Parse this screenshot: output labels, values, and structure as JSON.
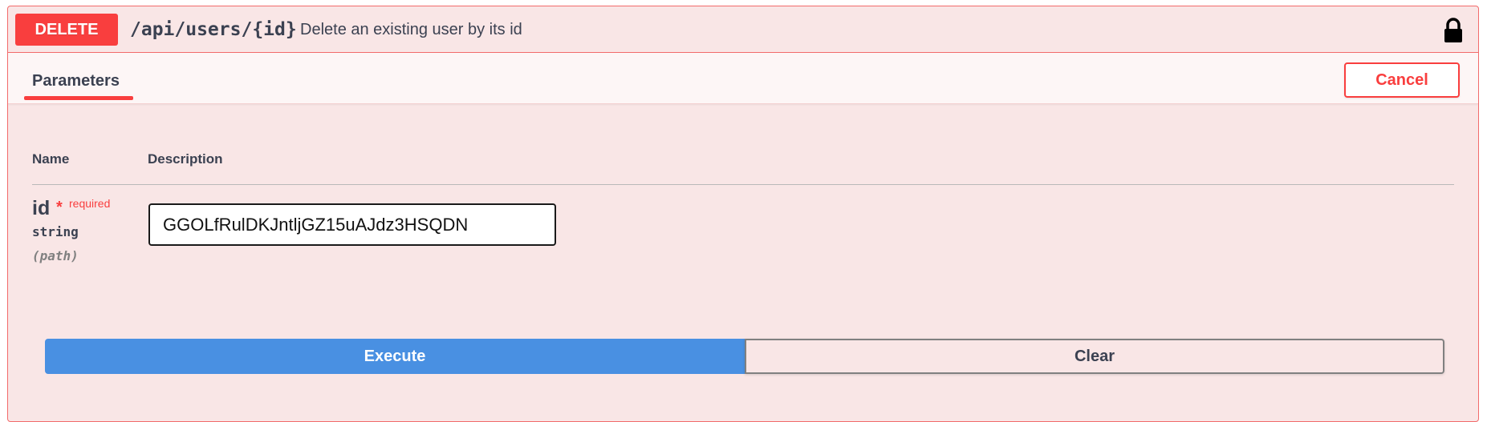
{
  "operation": {
    "method": "DELETE",
    "path": "/api/users/{id}",
    "summary": "Delete an existing user by its id",
    "locked": true
  },
  "tabs": {
    "parameters_label": "Parameters",
    "cancel_label": "Cancel"
  },
  "table": {
    "col_name": "Name",
    "col_description": "Description"
  },
  "parameter": {
    "name": "id",
    "required_star": "*",
    "required_label": "required",
    "type": "string",
    "location": "(path)",
    "value": "GGOLfRulDKJntljGZ15uAJdz3HSQDN"
  },
  "actions": {
    "execute_label": "Execute",
    "clear_label": "Clear"
  },
  "colors": {
    "delete_accent": "#f93e3e",
    "execute_blue": "#4990e2",
    "block_background": "#f9e6e6"
  }
}
